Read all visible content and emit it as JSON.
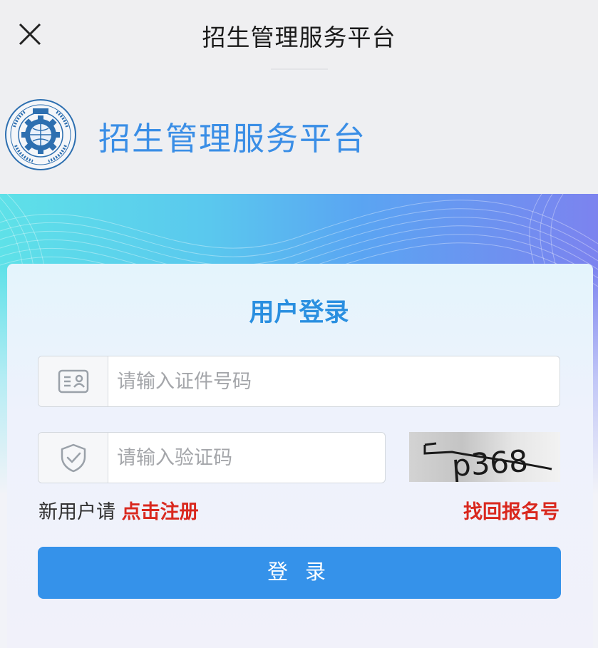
{
  "topbar": {
    "title": "招生管理服务平台",
    "close_icon": "close-icon"
  },
  "header": {
    "brand": "招生管理服务平台",
    "logo_icon": "emblem-logo"
  },
  "login": {
    "title": "用户登录",
    "id_field": {
      "placeholder": "请输入证件号码",
      "value": "",
      "icon": "id-card-icon"
    },
    "code_field": {
      "placeholder": "请输入验证码",
      "value": "",
      "icon": "shield-check-icon"
    },
    "captcha_text": "p368",
    "register_prefix": "新用户请",
    "register_link": "点击注册",
    "recover_link": "找回报名号",
    "submit_label": "登 录"
  },
  "colors": {
    "accent": "#3592ea",
    "brand_text": "#3a8ee6",
    "link_red": "#d9281e"
  }
}
